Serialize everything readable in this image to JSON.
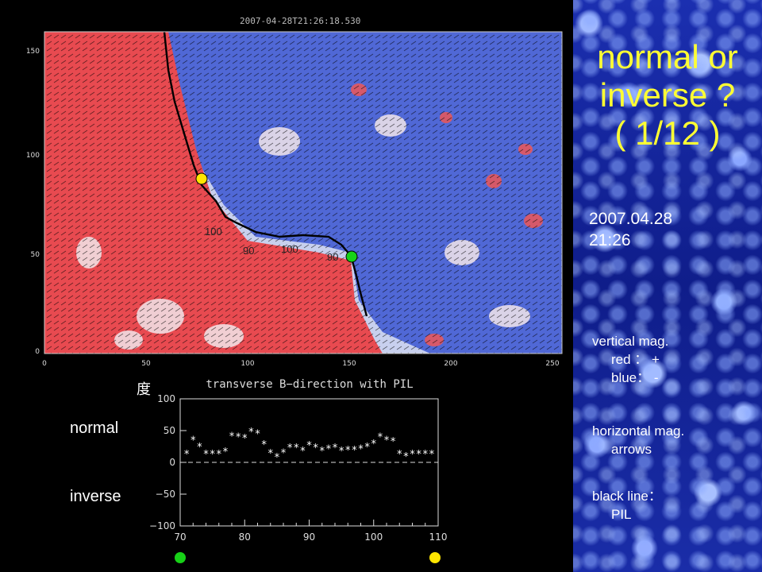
{
  "slide": {
    "title_lines": [
      "normal or",
      "inverse ?",
      "( 1/12 )"
    ],
    "date": "2007.04.28",
    "time": "21:26",
    "legend": {
      "vertical_heading": "vertical mag.",
      "vertical_red": "red ： +",
      "vertical_blue": "blue： -",
      "horizontal_heading": "horizontal mag.",
      "horizontal_item": "arrows",
      "pil_heading": "black line：",
      "pil_item": "PIL"
    }
  },
  "magnetogram": {
    "timestamp": "2007-04-28T21:26:18.530",
    "x_ticks": [
      "0",
      "50",
      "100",
      "150",
      "200",
      "250"
    ],
    "y_ticks": [
      "0",
      "50",
      "100",
      "150"
    ],
    "annotations": [
      "100",
      "90",
      "100",
      "90"
    ],
    "colors": {
      "positive": "#e8454a",
      "negative": "#4a66d8",
      "pil": "#000000"
    },
    "markers": [
      {
        "color": "#ffe600",
        "position": "upper end of PIL"
      },
      {
        "color": "#17d117",
        "position": "lower end of PIL"
      }
    ]
  },
  "plot": {
    "title": "transverse B−direction with PIL",
    "unit_label": "度",
    "normal_label": "normal",
    "inverse_label": "inverse",
    "y_ticks": [
      "100",
      "50",
      "0",
      "−50",
      "−100"
    ],
    "x_ticks": [
      "70",
      "80",
      "90",
      "100",
      "110"
    ],
    "bottom_marker_left": "#17d117",
    "bottom_marker_right": "#ffe600"
  },
  "chart_data": {
    "type": "scatter",
    "title": "transverse B−direction with PIL",
    "ylabel": "度",
    "xlim": [
      70,
      110
    ],
    "ylim": [
      -100,
      100
    ],
    "reference_line": 0,
    "marker": "*",
    "x": [
      71,
      72,
      73,
      74,
      75,
      76,
      77,
      78,
      79,
      80,
      81,
      82,
      83,
      84,
      85,
      86,
      87,
      88,
      89,
      90,
      91,
      92,
      93,
      94,
      95,
      96,
      97,
      98,
      99,
      100,
      101,
      102,
      103,
      104,
      105,
      106,
      107,
      108,
      109
    ],
    "y": [
      15,
      37,
      26,
      15,
      15,
      15,
      19,
      43,
      42,
      40,
      50,
      47,
      30,
      16,
      10,
      17,
      25,
      25,
      20,
      29,
      25,
      20,
      23,
      25,
      20,
      21,
      21,
      23,
      26,
      31,
      42,
      37,
      35,
      15,
      11,
      15,
      15,
      15,
      15
    ]
  }
}
